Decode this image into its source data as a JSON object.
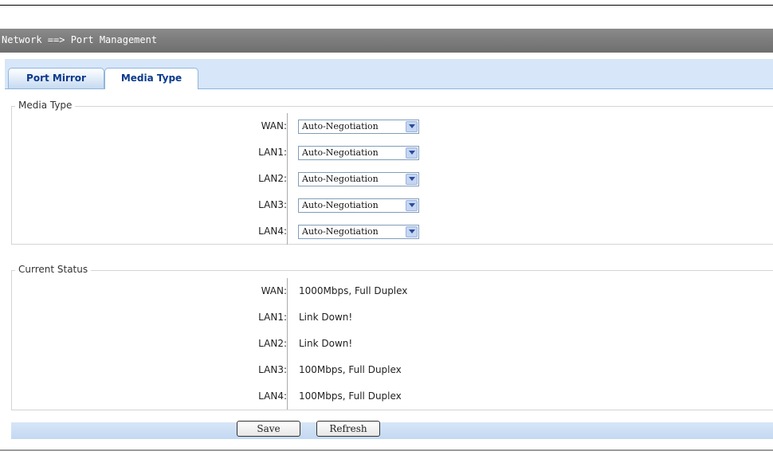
{
  "breadcrumb": "Network ==> Port Management",
  "tabs": [
    {
      "label": "Port Mirror",
      "active": false
    },
    {
      "label": "Media Type",
      "active": true
    }
  ],
  "media_type": {
    "legend": "Media Type",
    "rows": [
      {
        "label": "WAN:",
        "value": "Auto-Negotiation"
      },
      {
        "label": "LAN1:",
        "value": "Auto-Negotiation"
      },
      {
        "label": "LAN2:",
        "value": "Auto-Negotiation"
      },
      {
        "label": "LAN3:",
        "value": "Auto-Negotiation"
      },
      {
        "label": "LAN4:",
        "value": "Auto-Negotiation"
      }
    ]
  },
  "current_status": {
    "legend": "Current Status",
    "rows": [
      {
        "label": "WAN:",
        "value": "1000Mbps, Full Duplex"
      },
      {
        "label": "LAN1:",
        "value": "Link Down!"
      },
      {
        "label": "LAN2:",
        "value": "Link Down!"
      },
      {
        "label": "LAN3:",
        "value": "100Mbps, Full Duplex"
      },
      {
        "label": "LAN4:",
        "value": "100Mbps, Full Duplex"
      }
    ]
  },
  "buttons": {
    "save": "Save",
    "refresh": "Refresh"
  },
  "colors": {
    "header_bar": "#7a7a7a",
    "tab_strip": "#d7e6f8",
    "tab_text": "#0b3a8c"
  }
}
